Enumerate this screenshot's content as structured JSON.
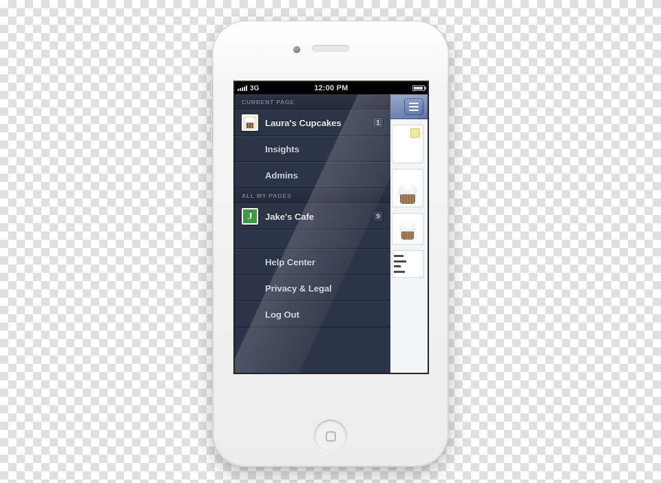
{
  "status_bar": {
    "carrier": "3G",
    "time": "12:00 PM"
  },
  "drawer": {
    "sections": {
      "current_page": {
        "header": "CURRENT PAGE",
        "page": {
          "label": "Laura's Cupcakes",
          "badge": "1"
        },
        "items": [
          {
            "label": "Insights"
          },
          {
            "label": "Admins"
          }
        ]
      },
      "all_my_pages": {
        "header": "ALL MY PAGES",
        "pages": [
          {
            "label": "Jake's Cafe",
            "badge": "9",
            "initial": "J"
          }
        ]
      },
      "footer_links": [
        {
          "label": "Help Center"
        },
        {
          "label": "Privacy & Legal"
        },
        {
          "label": "Log Out"
        }
      ]
    }
  },
  "colors": {
    "drawer_bg": "#2c3447",
    "nav_accent": "#5d75a8"
  }
}
